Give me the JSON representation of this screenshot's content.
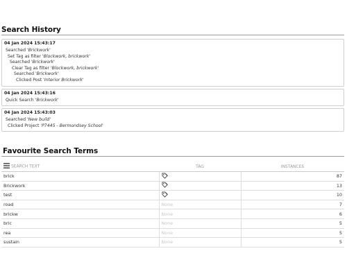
{
  "search_history": {
    "title": "Search History",
    "entries": [
      {
        "timestamp": "04 Jan 2024 15:43:17",
        "lines": [
          {
            "indent": 0,
            "prefix": "Searched ",
            "value": "'Brickwork'"
          },
          {
            "indent": 1,
            "prefix": "Set Tag as filter ",
            "value": "'Blockwork, brickwork'"
          },
          {
            "indent": 2,
            "prefix": "Searched ",
            "value": "'Brickwork'"
          },
          {
            "indent": 3,
            "prefix": "Clear Tag as filter ",
            "value": "'Blockwork, brickwork'"
          },
          {
            "indent": 4,
            "prefix": "Searched ",
            "value": "'Brickwork'"
          },
          {
            "indent": 5,
            "prefix": "Clicked Post ",
            "value": "'Interior Brickwork'"
          }
        ]
      },
      {
        "timestamp": "04 Jan 2024 15:43:16",
        "lines": [
          {
            "indent": 0,
            "prefix": "Quick Search ",
            "value": "'Brickwork'"
          }
        ]
      },
      {
        "timestamp": "04 Jan 2024 15:43:03",
        "lines": [
          {
            "indent": 0,
            "prefix": "Searched ",
            "value": "'New build'"
          },
          {
            "indent": 1,
            "prefix": "Clicked Project ",
            "value": "'P7445 - Bermondsey School'"
          }
        ]
      }
    ]
  },
  "favourites": {
    "title": "Favourite Search Terms",
    "columns": {
      "menu_icon": "menu-icon",
      "search_text": "SEARCH TEXT",
      "tag": "TAG",
      "instances": "INSTANCES"
    },
    "rows": [
      {
        "term": "brick",
        "tag_icon": "tag-icon",
        "tag": null,
        "instances": "87"
      },
      {
        "term": "Brickwork",
        "tag_icon": "tag-icon",
        "tag": null,
        "instances": "13"
      },
      {
        "term": "test",
        "tag_icon": "tag-icon",
        "tag": null,
        "instances": "10"
      },
      {
        "term": "road",
        "tag_icon": null,
        "tag": "None",
        "instances": "7"
      },
      {
        "term": "brickw",
        "tag_icon": null,
        "tag": "None",
        "instances": "6"
      },
      {
        "term": "bric",
        "tag_icon": null,
        "tag": "None",
        "instances": "5"
      },
      {
        "term": "rea",
        "tag_icon": null,
        "tag": "None",
        "instances": "5"
      },
      {
        "term": "sustain",
        "tag_icon": null,
        "tag": "None",
        "instances": "5"
      }
    ]
  }
}
